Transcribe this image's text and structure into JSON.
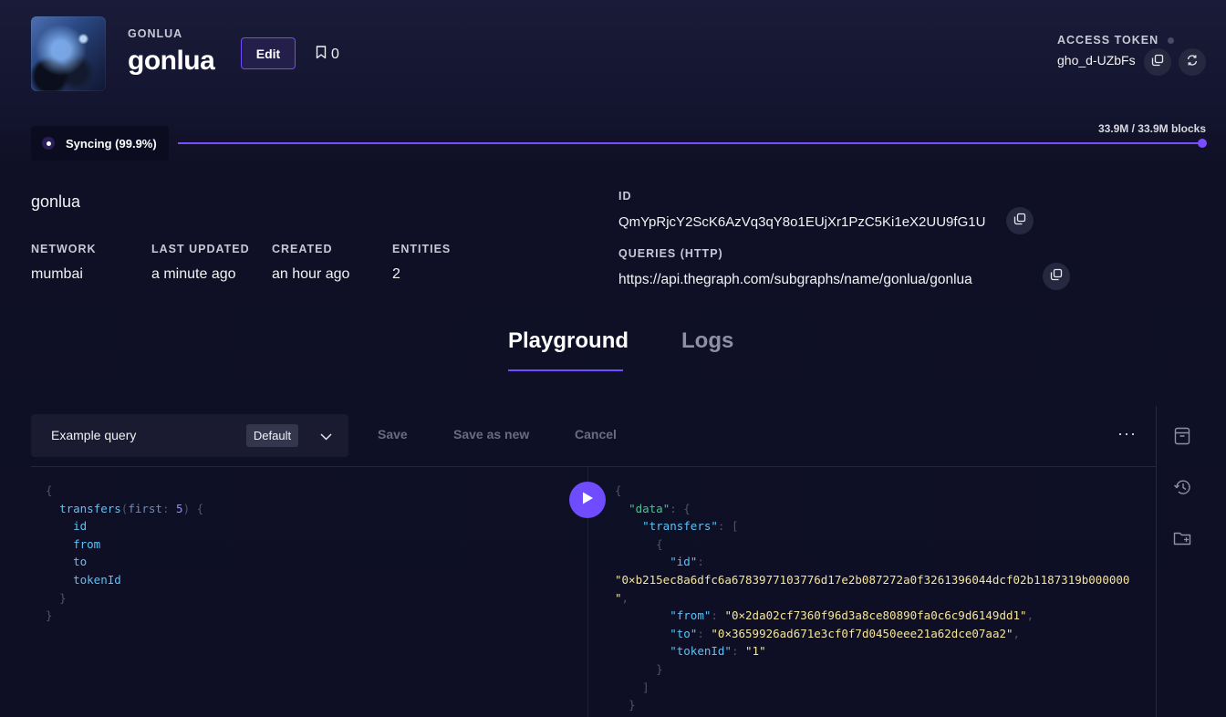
{
  "header": {
    "eyebrow": "GONLUA",
    "title": "gonlua",
    "edit_label": "Edit",
    "bookmark_count": "0"
  },
  "access_token": {
    "label": "ACCESS TOKEN",
    "value": "gho_d-UZbFs"
  },
  "sync": {
    "status": "Syncing (99.9%)",
    "blocks": "33.9M / 33.9M blocks",
    "progress": 0.999
  },
  "details": {
    "name": "gonlua",
    "network_label": "NETWORK",
    "network": "mumbai",
    "last_updated_label": "LAST UPDATED",
    "last_updated": "a minute ago",
    "created_label": "CREATED",
    "created": "an hour ago",
    "entities_label": "ENTITIES",
    "entities": "2",
    "id_label": "ID",
    "id": "QmYpRjcY2ScK6AzVq3qY8o1EUjXr1PzC5Ki1eX2UU9fG1U",
    "queries_label": "QUERIES (HTTP)",
    "queries_url": "https://api.thegraph.com/subgraphs/name/gonlua/gonlua"
  },
  "tabs": [
    {
      "label": "Playground",
      "active": true
    },
    {
      "label": "Logs",
      "active": false
    }
  ],
  "playground": {
    "query_name": "Example query",
    "badge": "Default",
    "save": "Save",
    "save_as_new": "Save as new",
    "cancel": "Cancel",
    "more": "···"
  },
  "query": {
    "open": "{",
    "entity": "transfers",
    "arg_name": "first",
    "arg_value": "5",
    "fields": [
      "id",
      "from",
      "to",
      "tokenId"
    ],
    "close_inner": "}",
    "close": "}"
  },
  "result": {
    "data_key": "\"data\"",
    "transfers_key": "\"transfers\"",
    "id_key": "\"id\"",
    "id_value_line1": "\"0×b215ec8a6dfc6a6783977103776d17e2b087272a0f3261396044dcf02b1187319b000000",
    "id_value_line2": "\"",
    "from_key": "\"from\"",
    "from_value": "\"0×2da02cf7360f96d3a8ce80890fa0c6c9d6149dd1\"",
    "to_key": "\"to\"",
    "to_value": "\"0×3659926ad671e3cf0f7d0450eee21a62dce07aa2\"",
    "tokenId_key": "\"tokenId\"",
    "tokenId_value": "\"1\""
  },
  "icons": {
    "bookmark": "bookmark-icon",
    "copy": "copy-icon",
    "refresh": "refresh-icon",
    "chevron": "chevron-down-icon",
    "play": "play-icon",
    "archive": "archive-icon",
    "history": "history-icon",
    "folder": "folder-icon"
  },
  "colors": {
    "accent": "#6f4cff",
    "background": "#0e0f24"
  }
}
